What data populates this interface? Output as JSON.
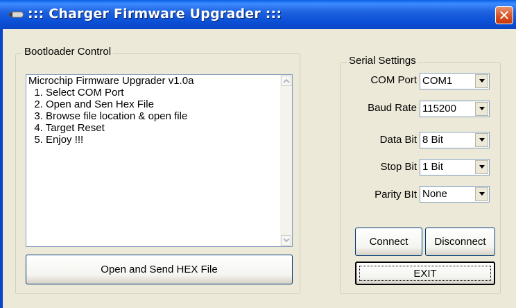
{
  "window": {
    "title": "::: Charger Firmware Upgrader :::",
    "close_glyph": "✕"
  },
  "bootloader": {
    "group_label": "Bootloader Control",
    "lines": [
      "Microchip Firmware Upgrader v1.0a",
      "  1. Select COM Port",
      "  2. Open and Sen Hex File",
      "  3. Browse file location & open file",
      "  4. Target Reset",
      "  5. Enjoy !!!"
    ],
    "open_send_button": "Open and Send HEX File"
  },
  "serial": {
    "group_label": "Serial Settings",
    "com_port": {
      "label": "COM Port",
      "value": "COM1"
    },
    "baud_rate": {
      "label": "Baud Rate",
      "value": "115200"
    },
    "data_bit": {
      "label": "Data Bit",
      "value": "8 Bit"
    },
    "stop_bit": {
      "label": "Stop Bit",
      "value": "1 Bit"
    },
    "parity_bit": {
      "label": "Parity BIt",
      "value": "None"
    },
    "connect_button": "Connect",
    "disconnect_button": "Disconnect",
    "exit_button": "EXIT"
  },
  "icons": {
    "app": "pen-icon",
    "close": "close-icon",
    "dropdown": "chevron-down-icon",
    "scroll_up": "scroll-up-icon",
    "scroll_down": "scroll-down-icon"
  },
  "colors": {
    "titlebar": "#0A5EE6",
    "window_bg": "#ECE9D8",
    "close_button": "#D74E1E",
    "button_border": "#003C74"
  }
}
